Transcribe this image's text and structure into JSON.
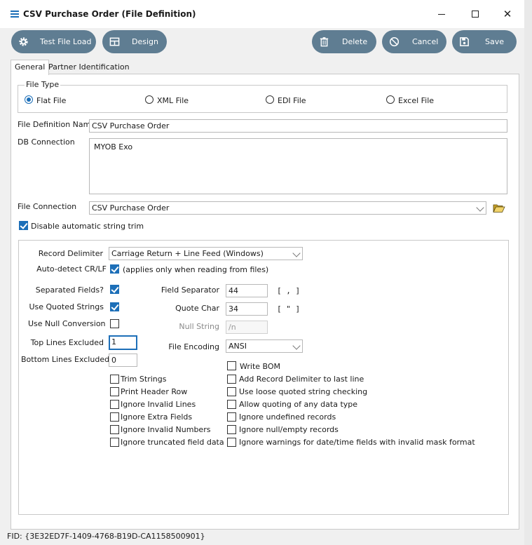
{
  "window": {
    "title": "CSV Purchase Order (File Definition)"
  },
  "toolbar": {
    "test_file_load": "Test File Load",
    "design": "Design",
    "delete": "Delete",
    "cancel": "Cancel",
    "save": "Save"
  },
  "tabs": {
    "general": "General",
    "partner": "Partner Identification"
  },
  "file_type": {
    "legend": "File Type",
    "flat": "Flat File",
    "xml": "XML File",
    "edi": "EDI File",
    "excel": "Excel File",
    "selected": "Flat File"
  },
  "form": {
    "file_def_name_label": "File Definition Name",
    "file_def_name_value": "CSV Purchase Order",
    "db_connection_label": "DB Connection",
    "db_connection_value": "MYOB Exo",
    "file_connection_label": "File Connection",
    "file_connection_value": "CSV Purchase Order",
    "disable_trim_label": "Disable automatic string trim",
    "disable_trim_checked": true
  },
  "settings": {
    "record_delimiter_label": "Record Delimiter",
    "record_delimiter_value": "Carriage Return + Line Feed (Windows)",
    "auto_detect_label": "Auto-detect CR/LF",
    "auto_detect_note": "(applies only when reading from files)",
    "separated_fields_label": "Separated Fields?",
    "use_quoted_label": "Use Quoted Strings",
    "use_null_label": "Use Null Conversion",
    "top_lines_label": "Top Lines Excluded",
    "top_lines_value": "1",
    "bottom_lines_label": "Bottom Lines Excluded",
    "bottom_lines_value": "0",
    "field_separator_label": "Field Separator",
    "field_separator_value": "44",
    "field_separator_char": "[ , ]",
    "quote_char_label": "Quote Char",
    "quote_char_value": "34",
    "quote_char_char": "[ \" ]",
    "null_string_label": "Null String",
    "null_string_value": "/n",
    "file_encoding_label": "File Encoding",
    "file_encoding_value": "ANSI"
  },
  "options_left": [
    "Trim Strings",
    "Print Header Row",
    "Ignore Invalid Lines",
    "Ignore Extra Fields",
    "Ignore Invalid Numbers",
    "Ignore truncated field data"
  ],
  "options_right": [
    "Write BOM",
    "Add Record Delimiter to last line",
    "Use loose quoted string checking",
    "Allow quoting of any data type",
    "Ignore undefined records",
    "Ignore null/empty records",
    "Ignore warnings for date/time fields with invalid mask format"
  ],
  "footer": {
    "fid": "FID: {3E32ED7F-1409-4768-B19D-CA1158500901}"
  },
  "colors": {
    "accent": "#1d6fb8",
    "toolbar_button": "#5f7d92"
  }
}
